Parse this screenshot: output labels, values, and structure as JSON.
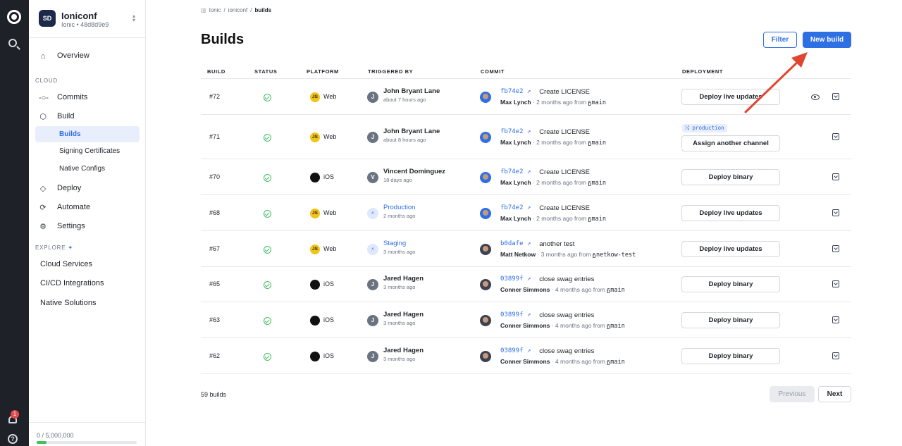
{
  "project": {
    "initials": "SD",
    "name": "Ioniconf",
    "sub": "Ionic • 48d8d9e9"
  },
  "nav": {
    "overview": "Overview",
    "cloud_section": "CLOUD",
    "commits": "Commits",
    "build": "Build",
    "builds": "Builds",
    "signing": "Signing Certificates",
    "native_configs": "Native Configs",
    "deploy": "Deploy",
    "automate": "Automate",
    "settings": "Settings",
    "explore_section": "EXPLORE",
    "cloud_services": "Cloud Services",
    "cicd": "CI/CD Integrations",
    "native_solutions": "Native Solutions"
  },
  "usage": {
    "text": "0 / 5,000,000",
    "fraction": 0.0
  },
  "notifications": {
    "count": "1"
  },
  "breadcrumb": {
    "org": "Ionic",
    "app": "ioniconf",
    "current": "builds"
  },
  "page": {
    "title": "Builds",
    "filter": "Filter",
    "new_build": "New build"
  },
  "table": {
    "headers": {
      "build": "BUILD",
      "status": "STATUS",
      "platform": "PLATFORM",
      "triggered": "TRIGGERED BY",
      "commit": "COMMIT",
      "deployment": "DEPLOYMENT"
    },
    "rows": [
      {
        "id": "#72",
        "platform_icon": "JS",
        "platform": "Web",
        "avatar": "J",
        "trigger": "John Bryant Lane",
        "when": "about 7 hours ago",
        "hash": "fb74e2 ↗",
        "message": "Create LICENSE",
        "author": "Max Lynch",
        "ago": " · 2 months ago from ",
        "branch": "ᵷmain",
        "tag": "",
        "deploy": "Deploy live updates"
      },
      {
        "id": "#71",
        "platform_icon": "JS",
        "platform": "Web",
        "avatar": "J",
        "trigger": "John Bryant Lane",
        "when": "about 8 hours ago",
        "hash": "fb74e2 ↗",
        "message": "Create LICENSE",
        "author": "Max Lynch",
        "ago": " · 2 months ago from ",
        "branch": "ᵷmain",
        "tag": "⤭ production",
        "deploy": "Assign another channel"
      },
      {
        "id": "#70",
        "platform_icon": "",
        "platform": "iOS",
        "avatar": "V",
        "trigger": "Vincent Dominguez",
        "when": "18 days ago",
        "hash": "fb74e2 ↗",
        "message": "Create LICENSE",
        "author": "Max Lynch",
        "ago": " · 2 months ago from ",
        "branch": "ᵷmain",
        "tag": "",
        "deploy": "Deploy binary"
      },
      {
        "id": "#68",
        "platform_icon": "JS",
        "platform": "Web",
        "avatar": "⚡",
        "trigger": "Production",
        "when": "2 months ago",
        "hash": "fb74e2 ↗",
        "message": "Create LICENSE",
        "author": "Max Lynch",
        "ago": " · 2 months ago from ",
        "branch": "ᵷmain",
        "tag": "",
        "deploy": "Deploy live updates"
      },
      {
        "id": "#67",
        "platform_icon": "JS",
        "platform": "Web",
        "avatar": "⚡",
        "trigger": "Staging",
        "when": "3 months ago",
        "hash": "b0dafe ↗",
        "message": "another test",
        "author": "Matt Netkow",
        "ago": " · 3 months ago from ",
        "branch": "ᵷnetkow-test",
        "tag": "",
        "deploy": "Deploy live updates"
      },
      {
        "id": "#65",
        "platform_icon": "",
        "platform": "iOS",
        "avatar": "J",
        "trigger": "Jared Hagen",
        "when": "3 months ago",
        "hash": "03899f ↗",
        "message": "close swag entries",
        "author": "Conner Simmons",
        "ago": " · 4 months ago from ",
        "branch": "ᵷmain",
        "tag": "",
        "deploy": "Deploy binary"
      },
      {
        "id": "#63",
        "platform_icon": "",
        "platform": "iOS",
        "avatar": "J",
        "trigger": "Jared Hagen",
        "when": "3 months ago",
        "hash": "03899f ↗",
        "message": "close swag entries",
        "author": "Conner Simmons",
        "ago": " · 4 months ago from ",
        "branch": "ᵷmain",
        "tag": "",
        "deploy": "Deploy binary"
      },
      {
        "id": "#62",
        "platform_icon": "",
        "platform": "iOS",
        "avatar": "J",
        "trigger": "Jared Hagen",
        "when": "3 months ago",
        "hash": "03899f ↗",
        "message": "close swag entries",
        "author": "Conner Simmons",
        "ago": " · 4 months ago from ",
        "branch": "ᵷmain",
        "tag": "",
        "deploy": "Deploy binary"
      }
    ]
  },
  "footer": {
    "count": "59 builds",
    "previous": "Previous",
    "next": "Next"
  },
  "colors": {
    "accent": "#2f6fe4",
    "rail": "#1e2128",
    "success": "#3fbf5e",
    "annotation": "#e0462f"
  }
}
